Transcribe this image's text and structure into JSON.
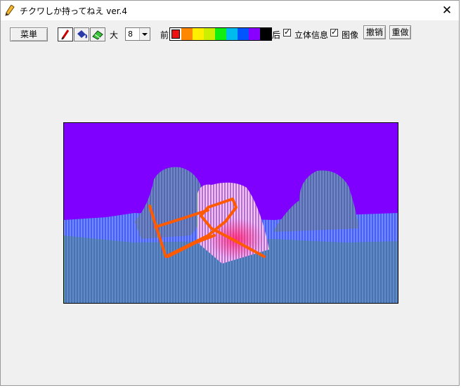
{
  "window": {
    "title": "チクワしか持ってねえ ver.4",
    "close_symbol": "✕"
  },
  "toolbar": {
    "menu_label": "菜単",
    "size_label": "大",
    "size_value": "8",
    "front_label": "前",
    "back_label": "后",
    "stereo_label": "立体信息",
    "image_label": "图像",
    "undo_label": "撤销",
    "redo_label": "重做",
    "stereo_checked": true,
    "image_checked": true,
    "tools": [
      {
        "icon": "pencil-icon",
        "active": true
      },
      {
        "icon": "bucket-icon",
        "active": false
      },
      {
        "icon": "eraser-icon",
        "active": false
      }
    ],
    "palette": [
      "#ee1111",
      "#ff8800",
      "#ffee00",
      "#ccee00",
      "#11ee11",
      "#00bbee",
      "#0055ff",
      "#8800ff",
      "#000000"
    ],
    "selected_color_index": 0
  },
  "colors": {
    "canvas_background": "#7f00ff",
    "stroke": "#ff5a00"
  }
}
